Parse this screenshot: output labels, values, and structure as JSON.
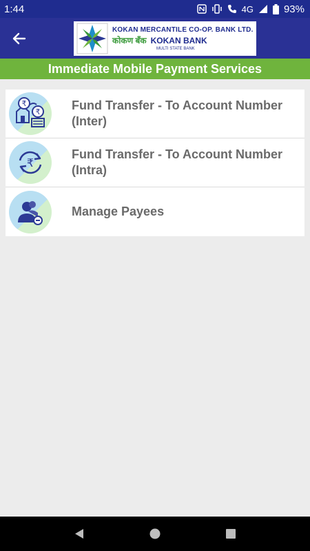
{
  "status_bar": {
    "time": "1:44",
    "network": "4G",
    "battery": "93%"
  },
  "header": {
    "logo": {
      "line1": "KOKAN MERCANTILE CO-OP. BANK LTD.",
      "line2_hindi": "कोकण बँक",
      "line2_brand": "KOKAN BANK",
      "line3": "MULTI STATE BANK"
    }
  },
  "title": "Immediate Mobile Payment Services",
  "menu": {
    "items": [
      {
        "line1": "Fund Transfer - To Account Number",
        "line2": "(Inter)",
        "icon": "inter-transfer-icon"
      },
      {
        "line1": "Fund Transfer - To Account Number",
        "line2": "(Intra)",
        "icon": "intra-transfer-icon"
      },
      {
        "line1": "Manage Payees",
        "line2": "",
        "icon": "manage-payees-icon"
      }
    ]
  },
  "colors": {
    "status_bar": "#1f2c8f",
    "app_bar": "#2a3195",
    "title_bar": "#6fb43d",
    "label": "#6a6a6a"
  }
}
